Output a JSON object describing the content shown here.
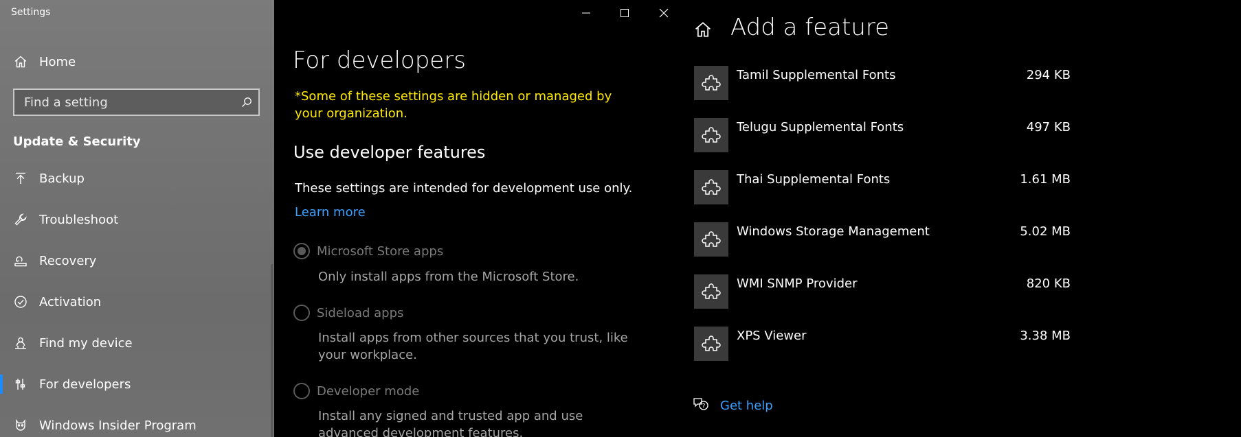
{
  "sidebar": {
    "window_title": "Settings",
    "home": {
      "label": "Home",
      "icon": "home-icon"
    },
    "search": {
      "placeholder": "Find a setting",
      "value": ""
    },
    "section_title": "Update & Security",
    "items": [
      {
        "label": "Backup",
        "icon": "backup-arrow-icon"
      },
      {
        "label": "Troubleshoot",
        "icon": "wrench-icon"
      },
      {
        "label": "Recovery",
        "icon": "recovery-icon"
      },
      {
        "label": "Activation",
        "icon": "check-circle-icon"
      },
      {
        "label": "Find my device",
        "icon": "person-location-icon"
      },
      {
        "label": "For developers",
        "icon": "developer-sliders-icon",
        "active": true
      },
      {
        "label": "Windows Insider Program",
        "icon": "insider-cat-icon"
      }
    ]
  },
  "developers": {
    "title": "For developers",
    "warning": "*Some of these settings are hidden or managed by your organization.",
    "subheading": "Use developer features",
    "description": "These settings are intended for development use only.",
    "learn_more": "Learn more",
    "options": [
      {
        "label": "Microsoft Store apps",
        "description": "Only install apps from the Microsoft Store.",
        "selected": true
      },
      {
        "label": "Sideload apps",
        "description": "Install apps from other sources that you trust, like your workplace.",
        "selected": false
      },
      {
        "label": "Developer mode",
        "description": "Install any signed and trusted app and use advanced development features.",
        "selected": false
      }
    ]
  },
  "add_feature": {
    "title": "Add a feature",
    "features": [
      {
        "name": "Tamil Supplemental Fonts",
        "size": "294 KB"
      },
      {
        "name": "Telugu Supplemental Fonts",
        "size": "497 KB"
      },
      {
        "name": "Thai Supplemental Fonts",
        "size": "1.61 MB"
      },
      {
        "name": "Windows Storage Management",
        "size": "5.02 MB"
      },
      {
        "name": "WMI SNMP Provider",
        "size": "820 KB"
      },
      {
        "name": "XPS Viewer",
        "size": "3.38 MB"
      }
    ],
    "help_label": "Get help"
  },
  "colors": {
    "accent": "#1a8cff",
    "link": "#3aa0ff",
    "warning": "#ffea00"
  }
}
